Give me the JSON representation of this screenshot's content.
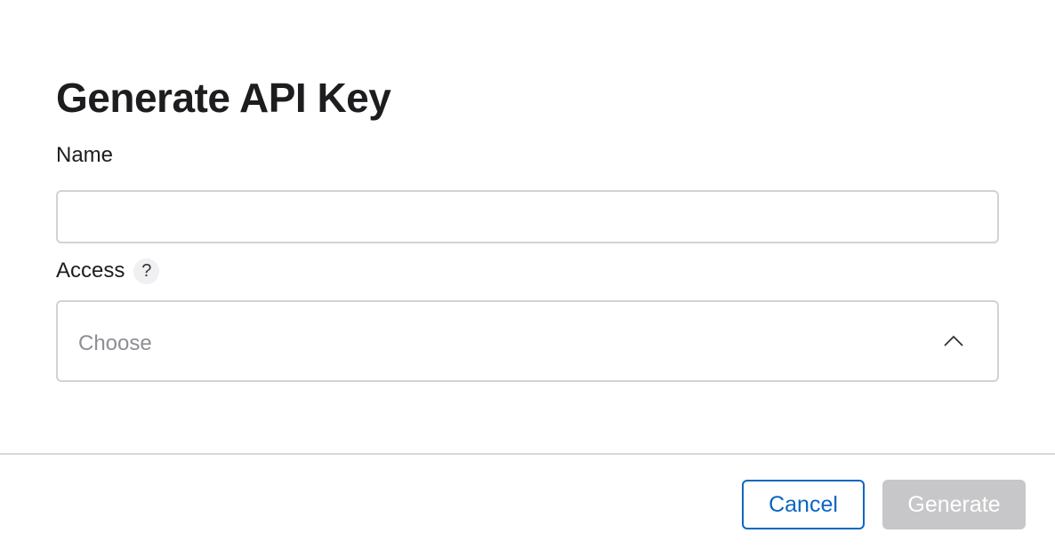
{
  "dialog": {
    "title": "Generate API Key",
    "name_field": {
      "label": "Name",
      "value": "",
      "placeholder": ""
    },
    "access_field": {
      "label": "Access",
      "help_glyph": "?",
      "placeholder": "Choose",
      "expanded": true,
      "icon": "chevron-up-icon"
    },
    "footer": {
      "cancel_label": "Cancel",
      "generate_label": "Generate",
      "generate_enabled": false
    }
  },
  "colors": {
    "accent": "#0a66c2",
    "disabled_button": "#c7c7c9",
    "input_border": "#d2d2d7",
    "placeholder_text": "#8e8e93"
  }
}
